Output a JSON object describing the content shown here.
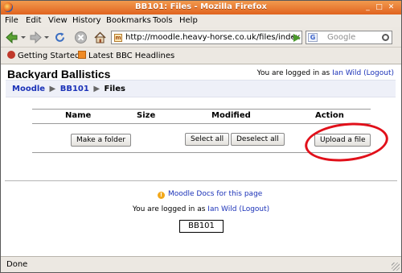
{
  "window": {
    "title": "BB101: Files - Mozilla Firefox"
  },
  "menu": {
    "items": [
      "File",
      "Edit",
      "View",
      "History",
      "Bookmarks",
      "Tools",
      "Help"
    ]
  },
  "nav": {
    "url": "http://moodle.heavy-horse.co.uk/files/index",
    "favicon_text": "m",
    "search_engine": "G",
    "search_placeholder": "Google"
  },
  "bookmarks": [
    "Getting Started",
    "Latest BBC Headlines"
  ],
  "site": {
    "title": "Backyard Ballistics",
    "logged_in_prefix": "You are logged in as",
    "user_name": "Ian Wild",
    "logout": "(Logout)"
  },
  "breadcrumb": {
    "items": [
      "Moodle",
      "BB101",
      "Files"
    ],
    "separator": "▶"
  },
  "files_table": {
    "headers": {
      "name": "Name",
      "size": "Size",
      "modified": "Modified",
      "action": "Action"
    },
    "buttons": {
      "make_folder": "Make a folder",
      "select_all": "Select all",
      "deselect_all": "Deselect all",
      "upload": "Upload a file"
    }
  },
  "footer": {
    "docs_link": "Moodle Docs for this page",
    "course_button": "BB101"
  },
  "status": {
    "text": "Done"
  },
  "colors": {
    "highlight": "#e1101a",
    "link": "#1b32b8",
    "titlebar": "#e0631f"
  }
}
